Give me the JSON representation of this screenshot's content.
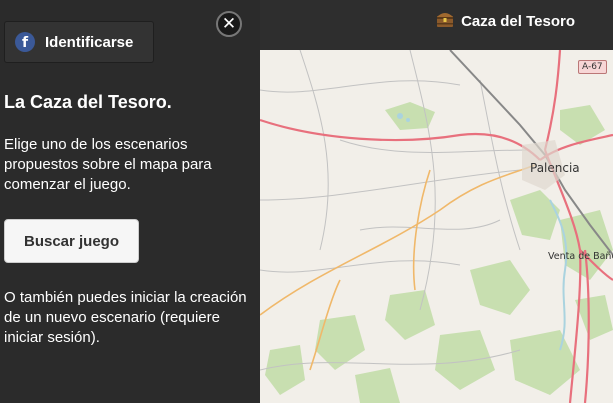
{
  "header": {
    "brand_label": "Caza del Tesoro",
    "brand_icon": "treasure-chest-icon"
  },
  "panel": {
    "login_label": "Identificarse",
    "login_icon": "facebook-icon",
    "close_icon": "close-icon",
    "title": "La Caza del Tesoro.",
    "intro_text": "Elige uno de los escenarios propuestos sobre el mapa para comenzar el juego.",
    "search_button_label": "Buscar juego",
    "alt_text": "O también puedes iniciar la creación de un nuevo escenario (requiere iniciar sesión)."
  },
  "map": {
    "road_shield": "A-67",
    "city_label": "Palencia",
    "town_label": "Venta de Baño",
    "colors": {
      "background": "#f2efe9",
      "forest": "#c8dfb0",
      "motorway": "#e8707d",
      "primary_road": "#f0b86a",
      "minor_road": "#bbbbbb",
      "water": "#aad3df"
    }
  },
  "colors": {
    "panel_bg": "#2b2b2b",
    "topbar_bg": "#2e2e2e",
    "facebook_blue": "#3b5998"
  }
}
